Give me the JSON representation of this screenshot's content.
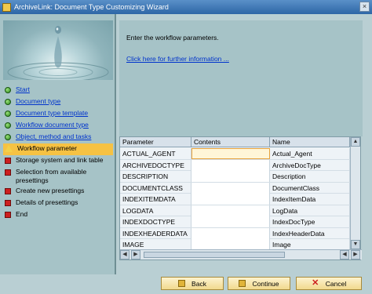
{
  "window": {
    "title": "ArchiveLink: Document Type Customizing Wizard",
    "close_glyph": "×"
  },
  "steps": [
    {
      "label": "Start",
      "state": "done"
    },
    {
      "label": "Document type",
      "state": "done"
    },
    {
      "label": "Document type template",
      "state": "done"
    },
    {
      "label": "Workflow document type",
      "state": "done"
    },
    {
      "label": "Object, method and tasks",
      "state": "done"
    },
    {
      "label": "Workflow parameter",
      "state": "current"
    },
    {
      "label": "Storage system and link table",
      "state": "todo"
    },
    {
      "label": "Selection from available presettings",
      "state": "todo"
    },
    {
      "label": "Create new presettings",
      "state": "todo"
    },
    {
      "label": "Details of presettings",
      "state": "todo"
    },
    {
      "label": "End",
      "state": "todo"
    }
  ],
  "info": {
    "text": "Enter the workflow parameters.",
    "link": "Click here for further information ..."
  },
  "table": {
    "headers": [
      "Parameter",
      "Contents",
      "Name"
    ],
    "rows": [
      [
        "ACTUAL_AGENT",
        "",
        "Actual_Agent"
      ],
      [
        "ARCHIVEDOCTYPE",
        "",
        "ArchiveDocType"
      ],
      [
        "DESCRIPTION",
        "",
        "Description"
      ],
      [
        "DOCUMENTCLASS",
        "",
        "DocumentClass"
      ],
      [
        "INDEXITEMDATA",
        "",
        "IndexItemData"
      ],
      [
        "LOGDATA",
        "",
        "LogData"
      ],
      [
        "INDEXDOCTYPE",
        "",
        "IndexDocType"
      ],
      [
        "INDEXHEADERDATA",
        "",
        "IndexHeaderData"
      ],
      [
        "IMAGE",
        "",
        "Image"
      ]
    ]
  },
  "buttons": {
    "back": "Back",
    "continue": "Continue",
    "cancel": "Cancel"
  }
}
